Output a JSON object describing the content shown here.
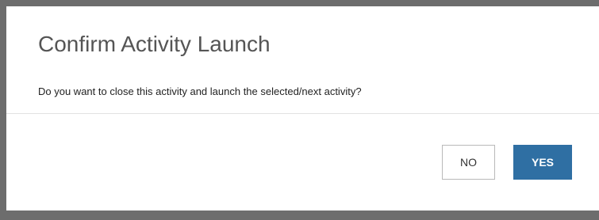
{
  "dialog": {
    "title": "Confirm Activity Launch",
    "message": "Do you want to close this activity and launch the selected/next activity?",
    "no_label": "NO",
    "yes_label": "YES"
  },
  "colors": {
    "overlay": "#6d6d6d",
    "dialog_background": "#ffffff",
    "primary_button": "#2f6fa3",
    "title_text": "#555555"
  }
}
